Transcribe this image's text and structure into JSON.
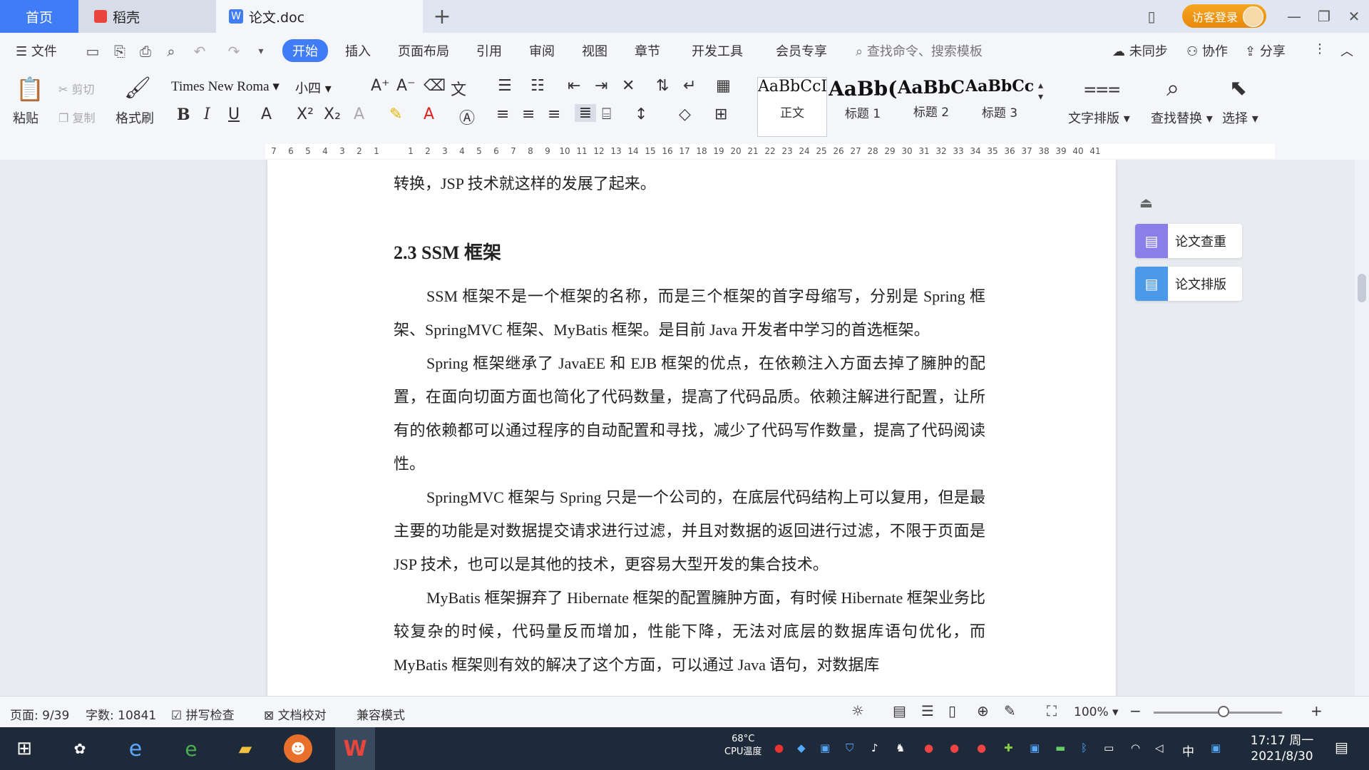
{
  "titlebar": {
    "tabs": [
      {
        "label": "首页"
      },
      {
        "label": "稻壳"
      },
      {
        "label": "论文.doc"
      }
    ],
    "login_label": "访客登录"
  },
  "menubar": {
    "file_label": "文件",
    "items": [
      "开始",
      "插入",
      "页面布局",
      "引用",
      "审阅",
      "视图",
      "章节",
      "开发工具",
      "会员专享"
    ],
    "search_placeholder": "查找命令、搜索模板",
    "sync_label": "未同步",
    "collab_label": "协作",
    "share_label": "分享"
  },
  "ribbon": {
    "paste_label": "粘贴",
    "cut_label": "剪切",
    "copy_label": "复制",
    "format_painter_label": "格式刷",
    "font_name": "Times New Roma",
    "font_size": "小四",
    "styles": [
      {
        "preview": "AaBbCcI",
        "label": "正文"
      },
      {
        "preview": "AaBb(",
        "label": "标题 1"
      },
      {
        "preview": "AaBbC",
        "label": "标题 2"
      },
      {
        "preview": "AaBbCcl",
        "label": "标题 3"
      }
    ],
    "text_layout_label": "文字排版",
    "find_replace_label": "查找替换",
    "select_label": "选择"
  },
  "ruler": {
    "marks": [
      "7",
      "6",
      "5",
      "4",
      "3",
      "2",
      "1",
      "",
      "1",
      "2",
      "3",
      "4",
      "5",
      "6",
      "7",
      "8",
      "9",
      "10",
      "11",
      "12",
      "13",
      "14",
      "15",
      "16",
      "17",
      "18",
      "19",
      "20",
      "21",
      "22",
      "23",
      "24",
      "25",
      "26",
      "27",
      "28",
      "29",
      "30",
      "31",
      "32",
      "33",
      "34",
      "35",
      "36",
      "37",
      "38",
      "39",
      "40",
      "41"
    ]
  },
  "document": {
    "line_top": "转换，JSP 技术就这样的发展了起来。",
    "heading": "2.3 SSM 框架",
    "paragraphs": [
      "SSM 框架不是一个框架的名称，而是三个框架的首字母缩写，分别是 Spring 框架、SpringMVC 框架、MyBatis 框架。是目前 Java 开发者中学习的首选框架。",
      "Spring 框架继承了 JavaEE 和 EJB 框架的优点，在依赖注入方面去掉了臃肿的配置，在面向切面方面也简化了代码数量，提高了代码品质。依赖注解进行配置，让所有的依赖都可以通过程序的自动配置和寻找，减少了代码写作数量，提高了代码阅读性。",
      "SpringMVC 框架与 Spring 只是一个公司的，在底层代码结构上可以复用，但是最主要的功能是对数据提交请求进行过滤，并且对数据的返回进行过滤，不限于页面是 JSP 技术，也可以是其他的技术，更容易大型开发的集合技术。",
      "MyBatis 框架摒弃了 Hibernate 框架的配置臃肿方面，有时候 Hibernate 框架业务比较复杂的时候，代码量反而增加，性能下降，无法对底层的数据库语句优化，而 MyBatis 框架则有效的解决了这个方面，可以通过 Java 语句，对数据库"
    ]
  },
  "side_panel": {
    "check_label": "论文查重",
    "layout_label": "论文排版"
  },
  "statusbar": {
    "page": "页面: 9/39",
    "words": "字数: 10841",
    "spell": "拼写检查",
    "proof": "文档校对",
    "compat": "兼容模式",
    "zoom": "100%"
  },
  "taskbar": {
    "temp": "68°C",
    "temp_label": "CPU温度",
    "ime": "中",
    "time": "17:17 周一",
    "date": "2021/8/30"
  },
  "colors": {
    "accent": "#3f7cf5",
    "login": "#f0a01a",
    "side_purple": "#8a7fe8",
    "side_blue": "#4a9ae8"
  }
}
